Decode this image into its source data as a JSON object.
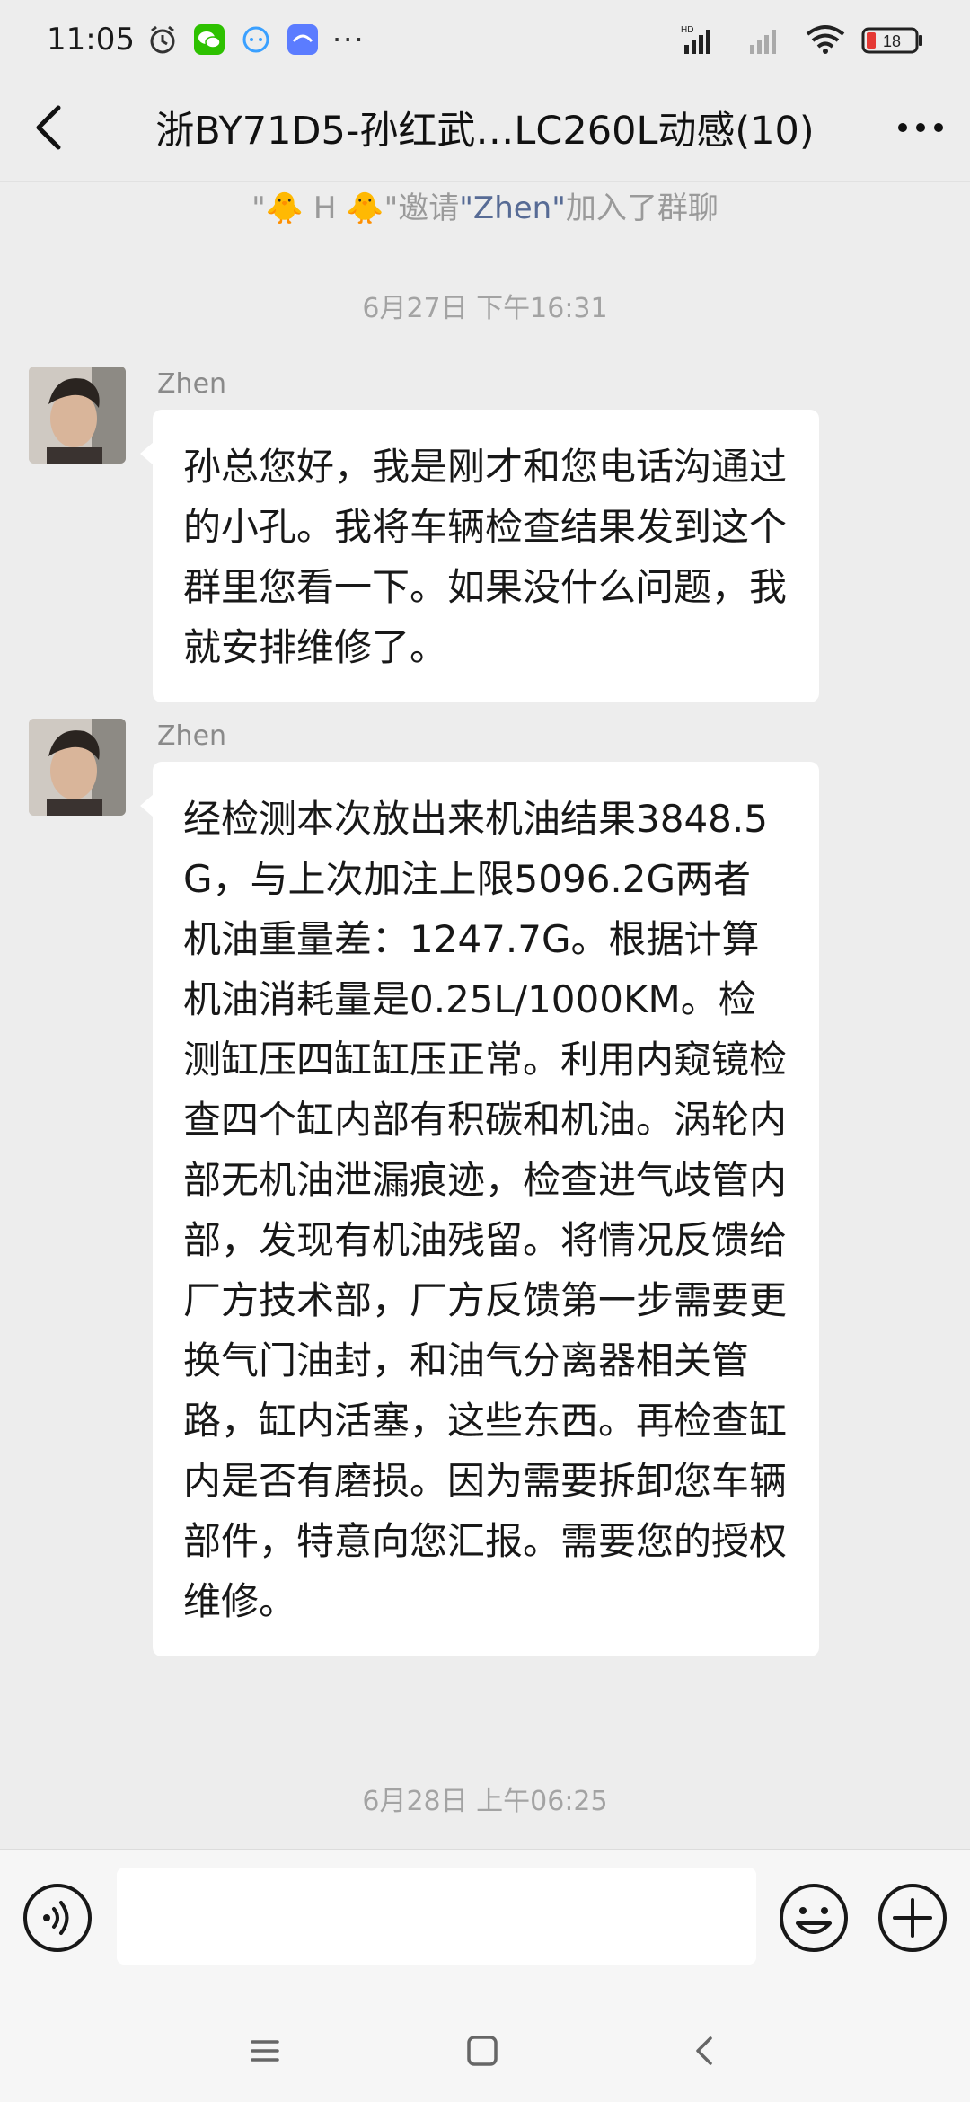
{
  "status_bar": {
    "time": "11:05",
    "network": "HD",
    "battery": "18",
    "more": "···"
  },
  "header": {
    "title": "浙BY71D5-孙红武…LC260L动感(10)",
    "back_icon": "chevron-left-icon",
    "more_icon": "more-dots-icon"
  },
  "chat": {
    "system_message": {
      "inviter": "\"🐥 H 🐥\"",
      "invited_text": "邀请",
      "invitee": "\"Zhen\"",
      "suffix": "加入了群聊"
    },
    "timestamp_1": "6月27日 下午16:31",
    "messages": [
      {
        "sender": "Zhen",
        "text": "孙总您好，我是刚才和您电话沟通过的小孔。我将车辆检查结果发到这个群里您看一下。如果没什么问题，我就安排维修了。"
      },
      {
        "sender": "Zhen",
        "text": "经检测本次放出来机油结果3848.5G，与上次加注上限5096.2G两者机油重量差：1247.7G。根据计算机油消耗量是0.25L/1000KM。检测缸压四缸缸压正常。利用内窥镜检查四个缸内部有积碳和机油。涡轮内部无机油泄漏痕迹，检查进气歧管内部，发现有机油残留。将情况反馈给厂方技术部，厂方反馈第一步需要更换气门油封，和油气分离器相关管路，缸内活塞，这些东西。再检查缸内是否有磨损。因为需要拆卸您车辆部件，特意向您汇报。需要您的授权维修。"
      }
    ],
    "timestamp_2": "6月28日 上午06:25"
  },
  "input_bar": {
    "voice_icon": "voice-icon",
    "input_value": "",
    "emoji_icon": "emoji-icon",
    "plus_icon": "plus-icon"
  },
  "system_nav": {
    "menu_icon": "menu-icon",
    "home_icon": "home-icon",
    "back_icon": "back-icon"
  }
}
